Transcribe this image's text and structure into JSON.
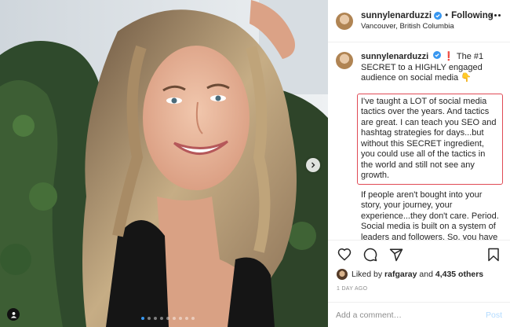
{
  "post": {
    "username": "sunnylenarduzzi",
    "follow_state": "Following",
    "separator": "•",
    "location": "Vancouver, British Columbia"
  },
  "caption": {
    "username": "sunnylenarduzzi",
    "exclaim": "❗",
    "intro": "The #1 SECRET to a HIGHLY engaged audience on social media",
    "intro_emoji": "👇",
    "highlighted": "I've taught a LOT of social media tactics over the years. And tactics are great. I can teach you SEO and hashtag strategies for days...but without this SECRET ingredient, you could use all of the tactics in the world and still not see any growth.",
    "continued": "If people aren't bought into your story, your journey, your experience...they don't care. Period. Social media is built on a system of leaders and followers. So, you have to see yourself as a leader in order for people to want to follow you. I prefer to say that you need to see"
  },
  "engagement": {
    "liked_by_prefix": "Liked by",
    "liked_by_user": "rafgaray",
    "and_text": "and",
    "others_count": "4,435 others",
    "timestamp": "1 DAY AGO"
  },
  "comment": {
    "placeholder": "Add a comment…",
    "post_label": "Post"
  },
  "carousel": {
    "total_slides": 9,
    "active_slide": 1
  },
  "colors": {
    "verified_blue": "#3897f0",
    "highlight_border": "#e04a55",
    "post_button_disabled": "#b3dbff"
  },
  "icons": {
    "heart": "heart-icon",
    "comment": "comment-icon",
    "share": "share-icon",
    "bookmark": "bookmark-icon",
    "more": "more-options-icon",
    "carousel_next": "chevron-right-icon",
    "user_tag": "user-tag-icon"
  }
}
